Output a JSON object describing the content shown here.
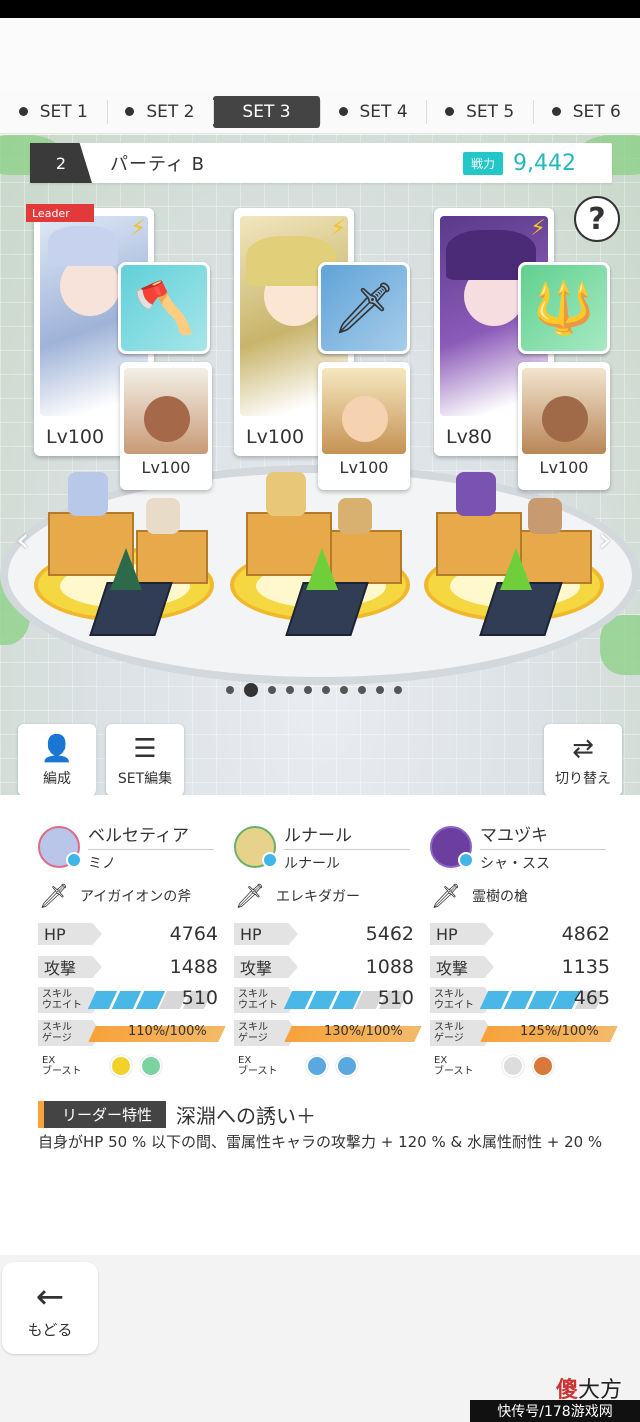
{
  "tabs": [
    "SET 1",
    "SET 2",
    "SET 3",
    "SET 4",
    "SET 5",
    "SET 6"
  ],
  "active_tab_index": 2,
  "party": {
    "number": "2",
    "name": "パーティ B",
    "power_label": "戦力",
    "power_value": "9,442"
  },
  "help": {
    "label": "?"
  },
  "slots": [
    {
      "leader_tag": "Leader",
      "main_level": "Lv100",
      "sub_level": "Lv100",
      "weapon_icon": "golden-axe-icon"
    },
    {
      "main_level": "Lv100",
      "sub_level": "Lv100",
      "weapon_icon": "lightning-dagger-icon"
    },
    {
      "main_level": "Lv80",
      "sub_level": "Lv100",
      "weapon_icon": "spear-icon"
    }
  ],
  "page_dots": {
    "count": 10,
    "active_index": 1
  },
  "actions": {
    "formation": "編成",
    "set_edit": "SET編集",
    "switch": "切り替え"
  },
  "members": [
    {
      "name": "ベルセティア",
      "sub": "ミノ",
      "weapon": "アイガイオンの斧",
      "hp_label": "HP",
      "hp": "4764",
      "atk_label": "攻撃",
      "atk": "1488",
      "wait_label": "スキル\nウエイト",
      "wait": "510",
      "wait_segments": 3,
      "gauge_label": "スキル\nゲージ",
      "gauge_pct": "110",
      "gauge_max": "100",
      "ex_label": "EX\nブースト",
      "ex_colors": [
        "#f2d22a",
        "#7bd3a0"
      ]
    },
    {
      "name": "ルナール",
      "sub": "ルナール",
      "weapon": "エレキダガー",
      "hp_label": "HP",
      "hp": "5462",
      "atk_label": "攻撃",
      "atk": "1088",
      "wait_label": "スキル\nウエイト",
      "wait": "510",
      "wait_segments": 3,
      "gauge_label": "スキル\nゲージ",
      "gauge_pct": "130",
      "gauge_max": "100",
      "ex_label": "EX\nブースト",
      "ex_colors": [
        "#5aa8e0",
        "#5aa8e0"
      ]
    },
    {
      "name": "マユヅキ",
      "sub": "シャ・スス",
      "weapon": "霊樹の槍",
      "hp_label": "HP",
      "hp": "4862",
      "atk_label": "攻撃",
      "atk": "1135",
      "wait_label": "スキル\nウエイト",
      "wait": "465",
      "wait_segments": 4,
      "gauge_label": "スキル\nゲージ",
      "gauge_pct": "125",
      "gauge_max": "100",
      "ex_label": "EX\nブースト",
      "ex_colors": [
        "#dddddd",
        "#d9783a"
      ]
    }
  ],
  "leader_skill": {
    "tag": "リーダー特性",
    "name": "深淵への誘い＋",
    "desc": "自身がHP 50 % 以下の間、雷属性キャラの攻撃力 + 120 % & 水属性耐性 + 20 %"
  },
  "back": {
    "label": "もどる"
  },
  "watermark": {
    "text_red": "傻",
    "text": "大方",
    "bar": "快传号/178游戏网"
  },
  "colors": {
    "accent_teal": "#23c7c7",
    "gauge_orange": "#f7a23a",
    "wait_blue": "#4ab8e6",
    "leader_red": "#e23a3a"
  }
}
